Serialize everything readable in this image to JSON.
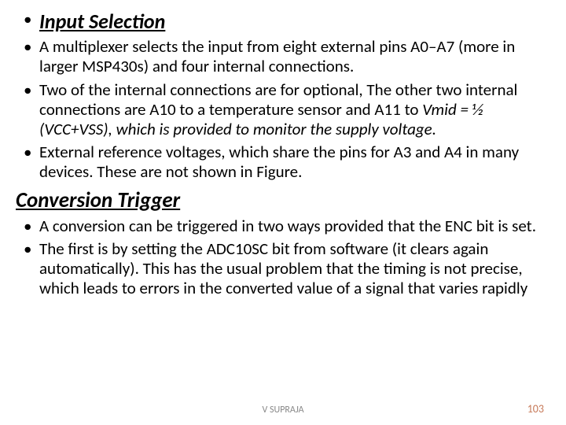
{
  "heading1": "Input Selection",
  "bullets1": [
    "A multiplexer selects the input from eight external pins A0–A7 (more in larger MSP430s) and four internal connections.",
    "Two of the internal connections are for optional, The other two internal connections are A10 to a temperature sensor and A11 to",
    "External reference voltages, which share the pins for A3 and A4 in many devices. These are not shown in Figure."
  ],
  "bullet1_italic": "Vmid = ½ (VCC+VSS), which is provided to monitor the supply voltage.",
  "heading2": "Conversion Trigger",
  "bullets2": [
    "A conversion can be triggered in two ways provided that the ENC bit is set.",
    "The first is by setting the ADC10SC bit from software (it clears again automatically). This has the usual problem that the timing is not precise, which leads to errors in the converted value of a signal that varies rapidly"
  ],
  "footer_center": "V SUPRAJA",
  "footer_right": "103"
}
